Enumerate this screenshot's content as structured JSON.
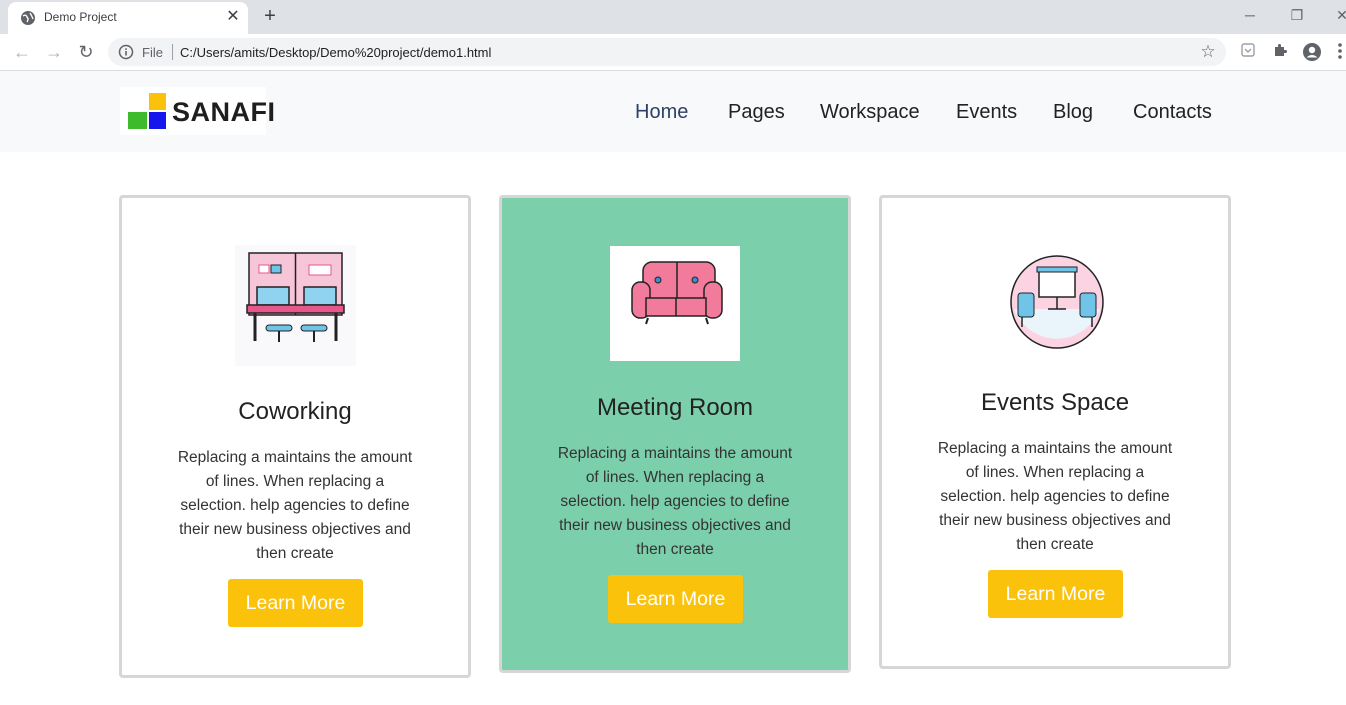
{
  "browser": {
    "tab_title": "Demo Project",
    "tab_close": "✕",
    "new_tab": "+",
    "file_label": "File",
    "url": "C:/Users/amits/Desktop/Demo%20project/demo1.html",
    "window_controls": [
      "─",
      "❐",
      "✕"
    ]
  },
  "site": {
    "logo_text": "SANAFI",
    "logo_colors": {
      "yellow": "#fbc20c",
      "green": "#3ebb2c",
      "blue": "#1515ee"
    },
    "nav": [
      {
        "label": "Home",
        "active": true
      },
      {
        "label": "Pages",
        "active": false
      },
      {
        "label": "Workspace",
        "active": false
      },
      {
        "label": "Events",
        "active": false
      },
      {
        "label": "Blog",
        "active": false
      },
      {
        "label": "Contacts",
        "active": false
      }
    ]
  },
  "cards": [
    {
      "icon": "coworking-desk-icon",
      "title": "Coworking",
      "text_lines": [
        "Replacing a maintains the amount",
        "of lines. When replacing a",
        "selection. help agencies to define",
        "their new business objectives and",
        "then create"
      ],
      "button": "Learn More"
    },
    {
      "icon": "sofa-icon",
      "title": "Meeting Room",
      "text_lines": [
        "Replacing a maintains the amount",
        "of lines. When replacing a",
        "selection. help agencies to define",
        "their new business objectives and",
        "then create"
      ],
      "button": "Learn More",
      "featured": true
    },
    {
      "icon": "presentation-room-icon",
      "title": "Events Space",
      "text_lines": [
        "Replacing a maintains the amount",
        "of lines. When replacing a",
        "selection. help agencies to define",
        "their new business objectives and",
        "then create"
      ],
      "button": "Learn More"
    }
  ],
  "colors": {
    "featured_card": "#7bcfab",
    "button": "#fbc20c",
    "active_nav": "#2f4166"
  }
}
